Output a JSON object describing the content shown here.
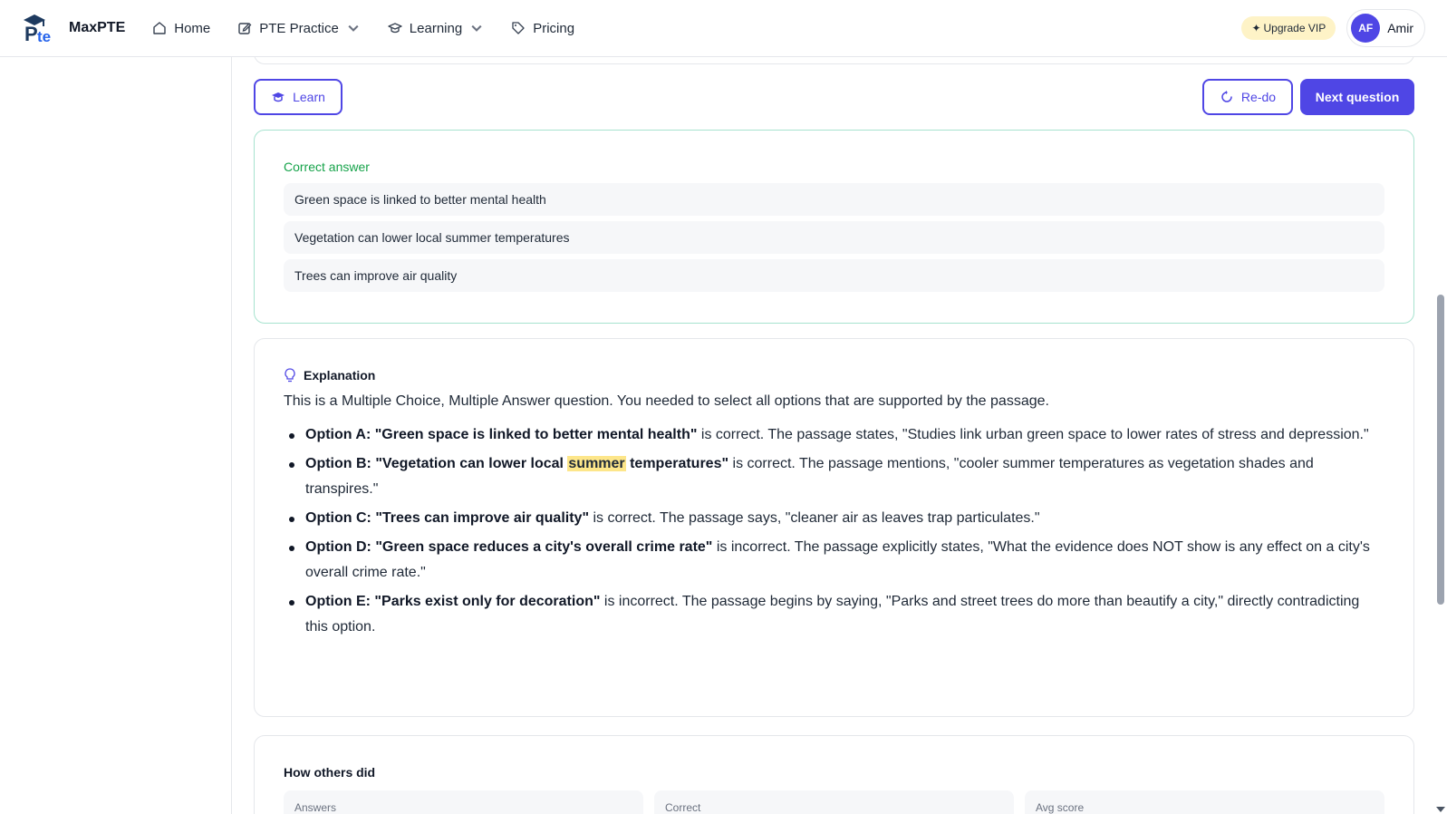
{
  "nav": {
    "brand_name": "MaxPTE",
    "links": [
      {
        "label": "Home",
        "icon": "home-icon"
      },
      {
        "label": "PTE Practice",
        "icon": "edit-icon"
      },
      {
        "label": "Learning",
        "icon": "graduation-cap-icon"
      },
      {
        "label": "Pricing",
        "icon": "tag-icon"
      }
    ],
    "upgrade_label": "Upgrade VIP",
    "avatar_initials": "AF",
    "user_name": "Amir"
  },
  "actions": {
    "learn_label": "Learn",
    "redo_label": "Re-do",
    "next_label": "Next question"
  },
  "correct": {
    "title": "Correct answer",
    "answers": [
      "Green space is linked to better mental health",
      "Vegetation can lower local summer temperatures",
      "Trees can improve air quality"
    ]
  },
  "explanation": {
    "title": "Explanation",
    "intro": "This is a Multiple Choice, Multiple Answer question. You needed to select all options that are supported by the passage.",
    "items": [
      {
        "bold": "Option A: \"Green space is linked to better mental health\"",
        "text": " is correct. The passage states, \"Studies link urban green space to lower rates of stress and depression.\""
      },
      {
        "bold_pre": "Option B: \"Vegetation can lower local ",
        "highlight": "summer",
        "bold_post": " temperatures\"",
        "text": " is correct. The passage mentions, \"cooler summer temperatures as vegetation shades and transpires.\""
      },
      {
        "bold": "Option C: \"Trees can improve air quality\"",
        "text": " is correct. The passage says, \"cleaner air as leaves trap particulates.\""
      },
      {
        "bold": "Option D: \"Green space reduces a city's overall crime rate\"",
        "text": " is incorrect. The passage explicitly states, \"What the evidence does NOT show is any effect on a city's overall crime rate.\""
      },
      {
        "bold": "Option E: \"Parks exist only for decoration\"",
        "text": " is incorrect. The passage begins by saying, \"Parks and street trees do more than beautify a city,\" directly contradicting this option."
      }
    ]
  },
  "others": {
    "title": "How others did",
    "stats": [
      "Answers",
      "Correct",
      "Avg score"
    ]
  },
  "colors": {
    "accent": "#4f46e5",
    "correct_green": "#16a34a",
    "highlight": "#fde68a",
    "upgrade_bg": "#fef3c7"
  }
}
